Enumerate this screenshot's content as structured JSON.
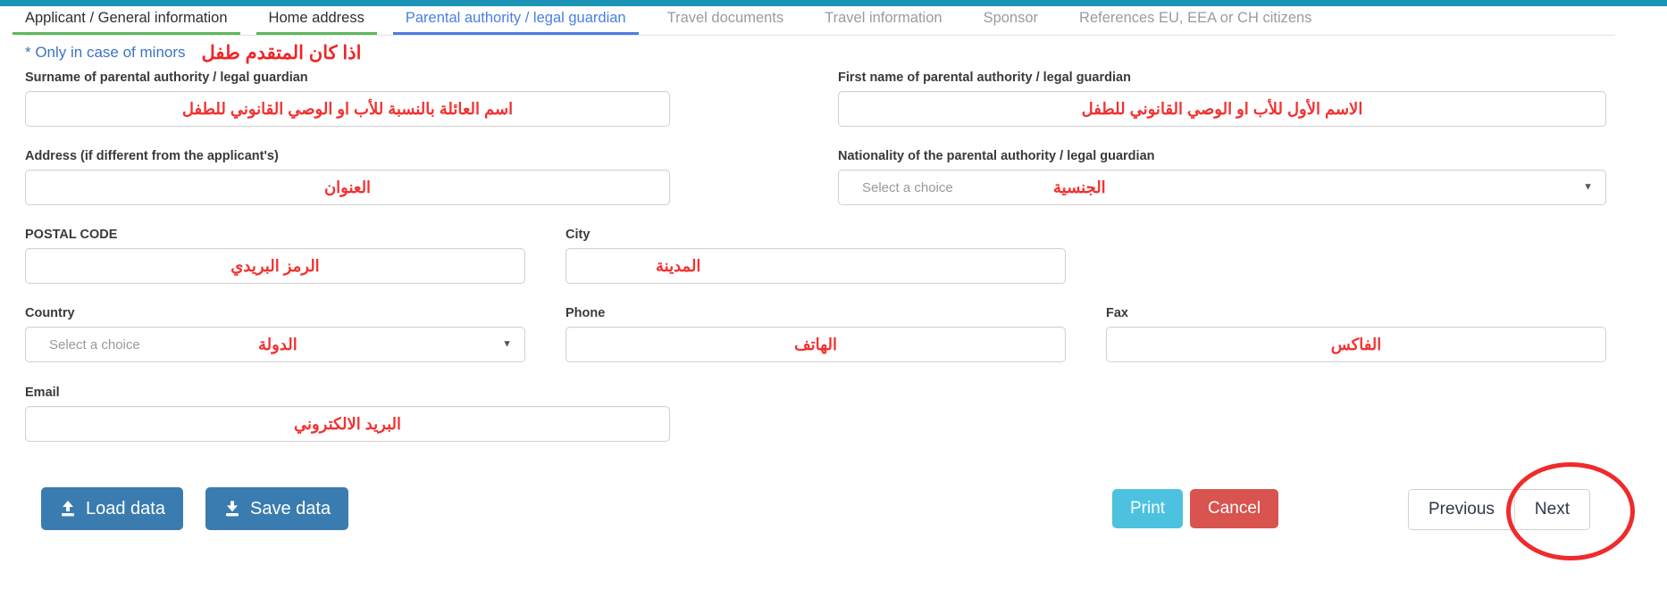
{
  "theme": {
    "top_bar_color": "#1b93b5",
    "tab_done_color": "#5cb85c",
    "tab_active_color": "#4a7fe0",
    "annotation_color": "#f23232",
    "primary_button_color": "#3a7cb0",
    "print_button_color": "#4cc2e0",
    "cancel_button_color": "#d9534f"
  },
  "tabs": [
    {
      "label": "Applicant / General information",
      "state": "done"
    },
    {
      "label": "Home address",
      "state": "done"
    },
    {
      "label": "Parental authority / legal guardian",
      "state": "active"
    },
    {
      "label": "Travel documents",
      "state": "inactive"
    },
    {
      "label": "Travel information",
      "state": "inactive"
    },
    {
      "label": "Sponsor",
      "state": "inactive"
    },
    {
      "label": "References EU, EEA or CH citizens",
      "state": "inactive"
    }
  ],
  "notice": {
    "text": "* Only in case of minors",
    "annotation": "اذا كان المتقدم طفل"
  },
  "fields": {
    "surname": {
      "label": "Surname of parental authority / legal guardian",
      "annotation": "اسم العائلة بالنسبة للأب او الوصي القانوني للطفل",
      "value": ""
    },
    "first_name": {
      "label": "First name of parental authority / legal guardian",
      "annotation": "الاسم الأول للأب او الوصي القانوني للطفل",
      "value": ""
    },
    "address": {
      "label": "Address (if different from the applicant's)",
      "annotation": "العنوان",
      "value": ""
    },
    "nationality": {
      "label": "Nationality of the parental authority / legal guardian",
      "annotation": "الجنسية",
      "placeholder": "Select a choice",
      "caret": "▼"
    },
    "postal_code": {
      "label": "POSTAL CODE",
      "annotation": "الرمز البريدي",
      "value": ""
    },
    "city": {
      "label": "City",
      "annotation": "المدينة",
      "value": ""
    },
    "country": {
      "label": "Country",
      "annotation": "الدولة",
      "placeholder": "Select a choice",
      "caret": "▼"
    },
    "phone": {
      "label": "Phone",
      "annotation": "الهاتف",
      "value": ""
    },
    "fax": {
      "label": "Fax",
      "annotation": "الفاكس",
      "value": ""
    },
    "email": {
      "label": "Email",
      "annotation": "البريد الالكتروني",
      "value": ""
    }
  },
  "actions": {
    "load_data": "Load data",
    "save_data": "Save data",
    "print": "Print",
    "cancel": "Cancel",
    "previous": "Previous",
    "next": "Next"
  }
}
